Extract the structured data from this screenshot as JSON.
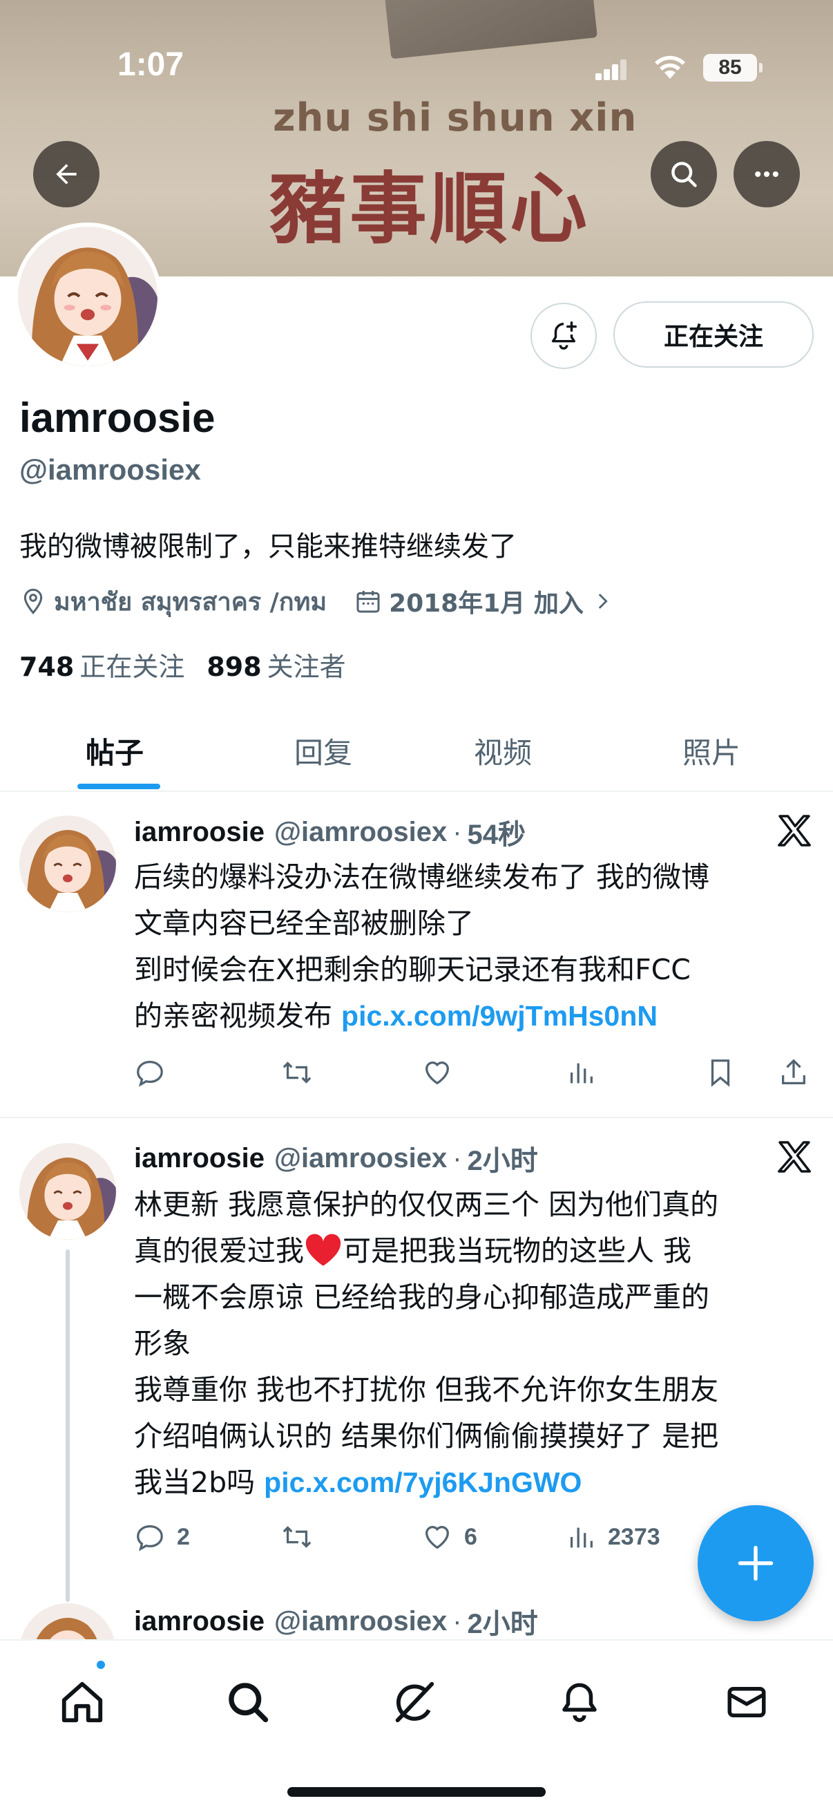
{
  "status_bar": {
    "time": "1:07",
    "battery": "85"
  },
  "banner": {
    "pinyin": "zhu shi shun xin",
    "hanzi": "豬事順心"
  },
  "profile": {
    "display_name": "iamroosie",
    "handle": "@iamroosiex",
    "bio": "我的微博被限制了，只能来推特继续发了",
    "location": "มหาชัย สมุทรสาคร /กทม",
    "joined": "2018年1月 加入",
    "following_count": "748",
    "following_label": "正在关注",
    "followers_count": "898",
    "followers_label": "关注者",
    "follow_button": "正在关注"
  },
  "tabs": [
    "帖子",
    "回复",
    "视频",
    "照片"
  ],
  "tweets": [
    {
      "name": "iamroosie",
      "handle": "@iamroosiex",
      "time": "54秒",
      "lines": [
        "后续的爆料没办法在微博继续发布了 我的微博",
        "文章内容已经全部被删除了",
        "到时候会在X把剩余的聊天记录还有我和FCC",
        "的亲密视频发布"
      ],
      "link": "pic.x.com/9wjTmHs0nN",
      "replies": "",
      "reposts": "",
      "likes": "",
      "views": ""
    },
    {
      "name": "iamroosie",
      "handle": "@iamroosiex",
      "time": "2小时",
      "lines": [
        "林更新 我愿意保护的仅仅两三个 因为他们真的",
        "真的很爱过我",
        "可是把我当玩物的这些人 我",
        "一概不会原谅 已经给我的身心抑郁造成严重的",
        "形象",
        "我尊重你 我也不打扰你 但我不允许你女生朋友",
        "介绍咱俩认识的 结果你们俩偷偷摸摸好了 是把",
        "我当2b吗"
      ],
      "link": "pic.x.com/7yj6KJnGWO",
      "replies": "2",
      "reposts": "",
      "likes": "6",
      "views": "2373"
    },
    {
      "name": "iamroosie",
      "handle": "@iamroosiex",
      "time": "2小时"
    }
  ],
  "colors": {
    "accent": "#1d9bf0",
    "text": "#0f1419",
    "muted": "#536471",
    "heart": "#e0245e"
  }
}
